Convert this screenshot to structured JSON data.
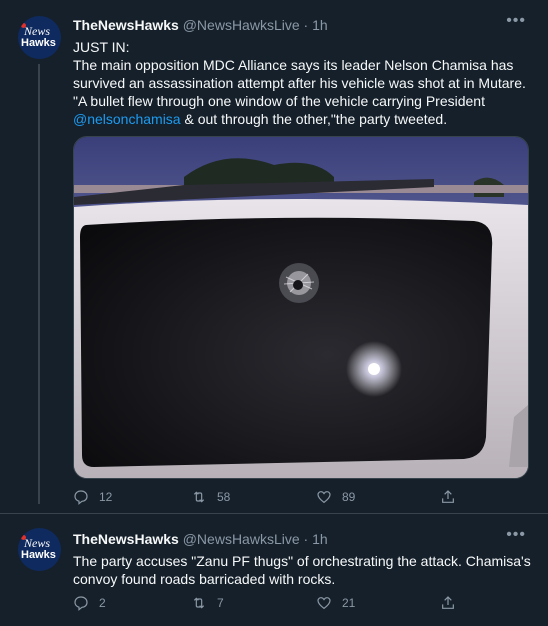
{
  "tweets": [
    {
      "name": "TheNewsHawks",
      "handle": "@NewsHawksLive",
      "time": "· 1h",
      "avatar_text_1": "News",
      "avatar_text_2": "Hawks",
      "lines": [
        "JUST IN:",
        "The main opposition MDC Alliance says its leader Nelson Chamisa has",
        "survived an assassination attempt after his vehicle was shot at in Mutare.",
        "\"A bullet flew through one window of the vehicle carrying President"
      ],
      "mention": "@nelsonchamisa",
      "after_mention": " & out through the other,\"the party tweeted.",
      "replies": "12",
      "retweets": "58",
      "likes": "89"
    },
    {
      "name": "TheNewsHawks",
      "handle": "@NewsHawksLive",
      "time": "· 1h",
      "avatar_text_1": "News",
      "avatar_text_2": "Hawks",
      "lines": [
        "The party accuses \"Zanu PF thugs\" of orchestrating the attack. Chamisa's",
        "convoy found roads barricaded with rocks."
      ],
      "replies": "2",
      "retweets": "7",
      "likes": "21"
    }
  ],
  "icons": {
    "more": "more-icon",
    "reply": "reply-icon",
    "retweet": "retweet-icon",
    "like": "heart-icon",
    "share": "share-icon"
  },
  "colors": {
    "background": "#15202b",
    "text": "#f7f9f9",
    "secondary": "#8b98a5",
    "link": "#1d9bf0",
    "divider": "#38444d"
  }
}
